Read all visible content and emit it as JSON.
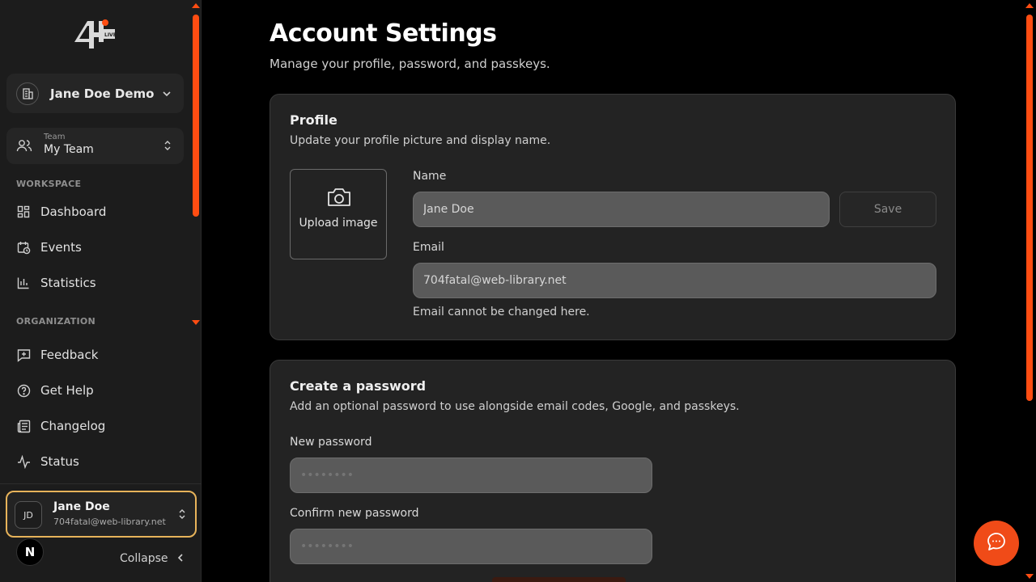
{
  "sidebar": {
    "org_name": "Jane Doe Demo",
    "team_small_label": "Team",
    "team_name": "My Team",
    "sections": {
      "workspace": "WORKSPACE",
      "organization": "ORGANIZATION"
    },
    "workspace_items": [
      {
        "label": "Dashboard",
        "icon": "dashboard-icon"
      },
      {
        "label": "Events",
        "icon": "calendar-clock-icon"
      },
      {
        "label": "Statistics",
        "icon": "bar-chart-icon"
      }
    ],
    "organization_items": [
      {
        "label": "Feedback",
        "icon": "feedback-icon"
      },
      {
        "label": "Get Help",
        "icon": "help-circle-icon"
      },
      {
        "label": "Changelog",
        "icon": "newspaper-icon"
      },
      {
        "label": "Status",
        "icon": "activity-icon"
      }
    ],
    "user": {
      "initials": "JD",
      "name": "Jane Doe",
      "email": "704fatal@web-library.net"
    },
    "n_badge": "N",
    "collapse_label": "Collapse",
    "accent_color": "#ff4d12"
  },
  "main": {
    "title": "Account Settings",
    "subtitle": "Manage your profile, password, and passkeys.",
    "profile": {
      "title": "Profile",
      "description": "Update your profile picture and display name.",
      "upload_label": "Upload image",
      "name_label": "Name",
      "name_value": "Jane Doe",
      "save_label": "Save",
      "email_label": "Email",
      "email_value": "704fatal@web-library.net",
      "email_hint": "Email cannot be changed here."
    },
    "password": {
      "title": "Create a password",
      "description": "Add an optional password to use alongside email codes, Google, and passkeys.",
      "new_label": "New password",
      "new_placeholder": "••••••••",
      "confirm_label": "Confirm new password",
      "confirm_placeholder": "••••••••"
    },
    "chat_icon": "chat-bubble-icon",
    "fab_color": "#f04b18"
  }
}
